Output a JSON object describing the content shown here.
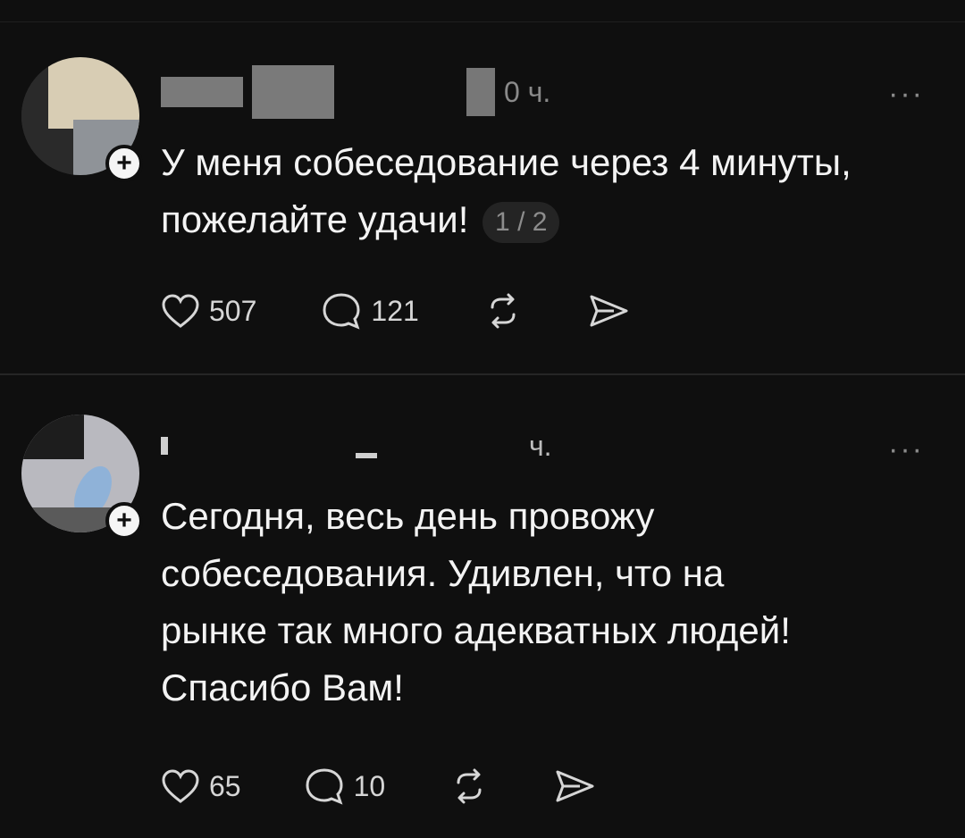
{
  "posts": [
    {
      "time": "0 ч.",
      "more": "···",
      "follow": "+",
      "text": "У меня собеседование через 4 минуты, пожелайте удачи!",
      "pager": "1 / 2",
      "likes": "507",
      "comments": "121"
    },
    {
      "time": "ч.",
      "more": "···",
      "follow": "+",
      "text_lines": [
        "Сегодня, весь день провожу",
        "собеседования. Удивлен, что на",
        "рынке так много адекватных людей!",
        "Спасибо Вам!"
      ],
      "likes": "65",
      "comments": "10"
    }
  ],
  "icons": [
    "heart-icon",
    "comment-icon",
    "repost-icon",
    "share-icon",
    "more-icon",
    "follow-plus-icon"
  ]
}
